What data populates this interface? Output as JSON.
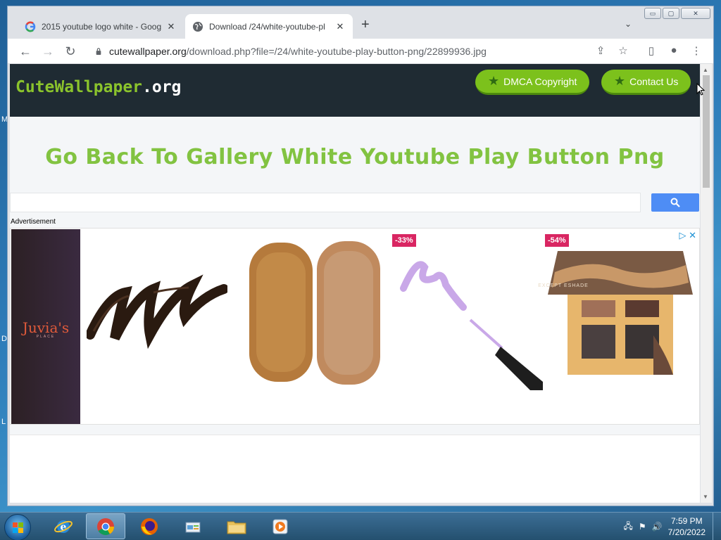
{
  "window": {
    "tabs": [
      {
        "title": "2015 youtube logo white - Goog",
        "close": "✕"
      },
      {
        "title": "Download /24/white-youtube-pl",
        "close": "✕"
      }
    ],
    "new_tab": "+",
    "tab_search": "⌄",
    "controls": {
      "minimize": "▭",
      "maximize": "▢",
      "close": "✕"
    }
  },
  "toolbar": {
    "back": "←",
    "forward": "→",
    "reload": "↻",
    "url_host": "cutewallpaper.org",
    "url_path": "/download.php?file=/24/white-youtube-play-button-png/22899936.jpg",
    "share": "⇪",
    "bookmark": "☆",
    "sidepanel": "▯",
    "profile": "●",
    "menu": "⋮"
  },
  "site": {
    "logo_part1": "CuteWallpaper",
    "logo_part2": ".org",
    "buttons": [
      {
        "label": "DMCA Copyright",
        "icon": "star-icon"
      },
      {
        "label": "Contact Us",
        "icon": "star-icon"
      }
    ],
    "page_title": "Go Back To Gallery White Youtube Play Button Png",
    "search": {
      "value": "",
      "placeholder": ""
    },
    "advertisement_label": "Advertisement"
  },
  "ad": {
    "brand": "Juvia's",
    "brand_sub": "PLACE",
    "discounts": [
      "-33%",
      "-54%"
    ],
    "palette_text": "EXCEPT ESHADE",
    "choices": "▷ ✕"
  },
  "taskbar": {
    "apps": [
      "internet-explorer",
      "chrome",
      "firefox",
      "control-panel",
      "file-explorer",
      "media-player"
    ],
    "time": "7:59 PM",
    "date": "7/20/2022"
  },
  "desktop": {
    "letters": [
      "M",
      "D",
      "L"
    ]
  },
  "colors": {
    "accent_green": "#7cc11c",
    "header_dark": "#1f2b33",
    "title_green": "#82c341",
    "search_blue": "#4e8df5",
    "discount_pink": "#d92662"
  }
}
